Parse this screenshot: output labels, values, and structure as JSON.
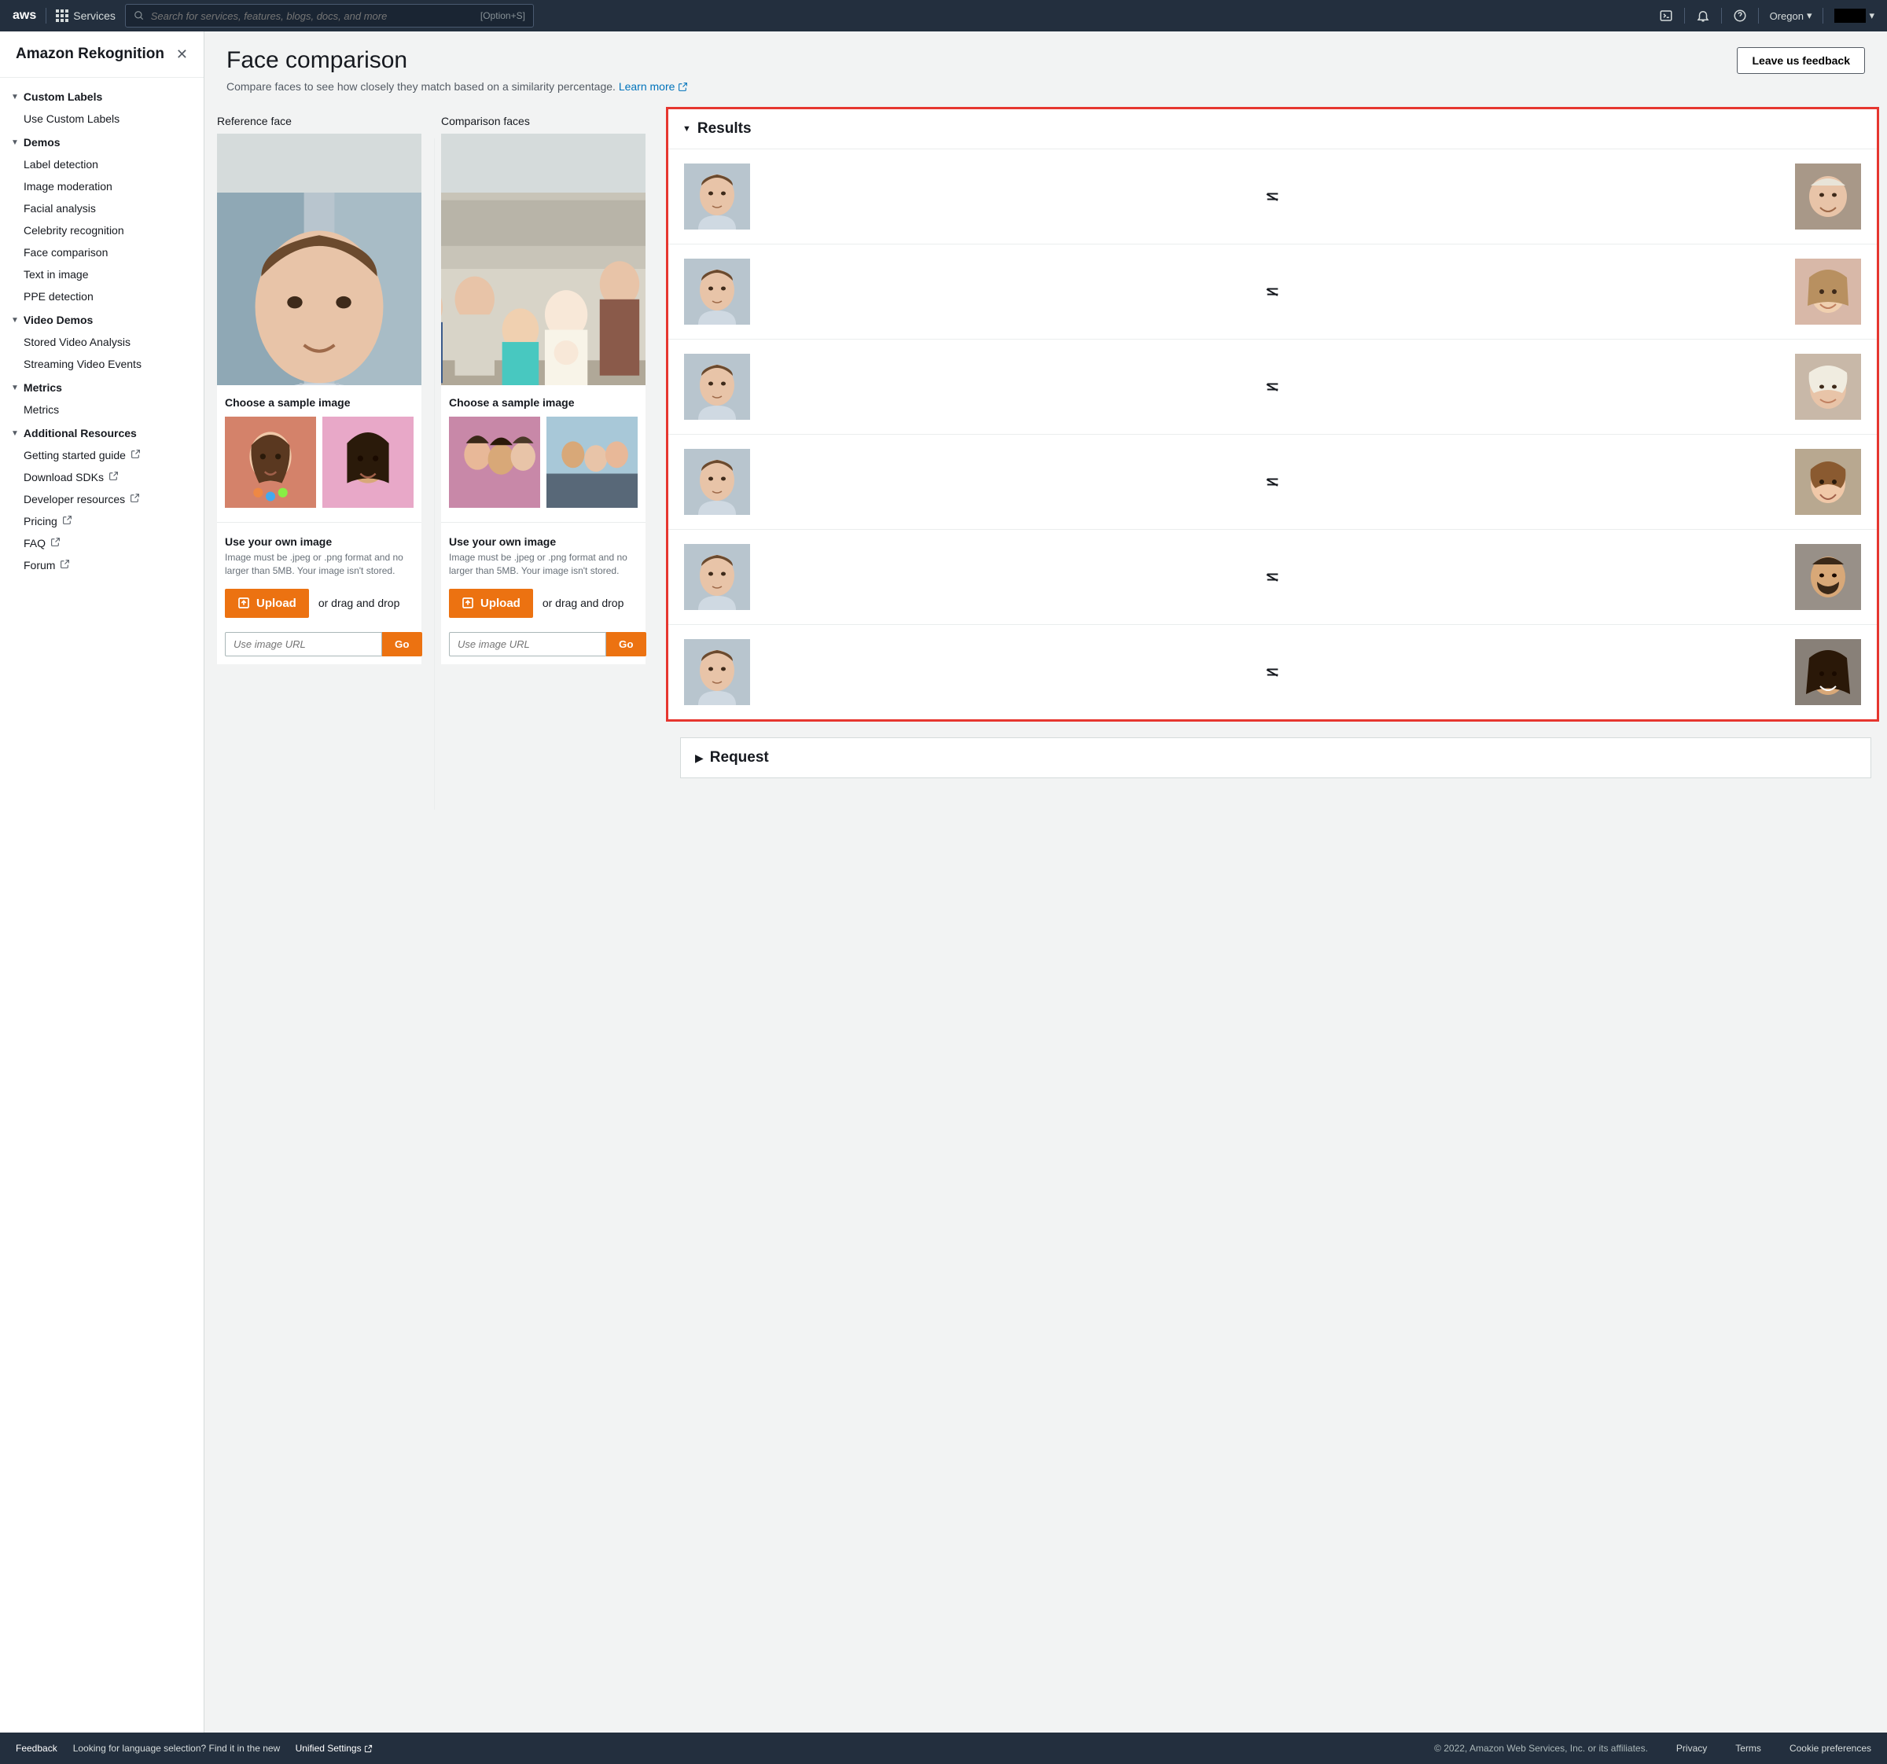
{
  "topnav": {
    "logo": "aws",
    "services": "Services",
    "search_placeholder": "Search for services, features, blogs, docs, and more",
    "shortcut": "[Option+S]",
    "region": "Oregon"
  },
  "sidebar": {
    "title": "Amazon Rekognition",
    "groups": [
      {
        "title": "Custom Labels",
        "items": [
          {
            "label": "Use Custom Labels"
          }
        ]
      },
      {
        "title": "Demos",
        "items": [
          {
            "label": "Label detection"
          },
          {
            "label": "Image moderation"
          },
          {
            "label": "Facial analysis"
          },
          {
            "label": "Celebrity recognition"
          },
          {
            "label": "Face comparison"
          },
          {
            "label": "Text in image"
          },
          {
            "label": "PPE detection"
          }
        ]
      },
      {
        "title": "Video Demos",
        "items": [
          {
            "label": "Stored Video Analysis"
          },
          {
            "label": "Streaming Video Events"
          }
        ]
      },
      {
        "title": "Metrics",
        "items": [
          {
            "label": "Metrics"
          }
        ]
      },
      {
        "title": "Additional Resources",
        "items": [
          {
            "label": "Getting started guide",
            "ext": true
          },
          {
            "label": "Download SDKs",
            "ext": true
          },
          {
            "label": "Developer resources",
            "ext": true
          },
          {
            "label": "Pricing",
            "ext": true
          },
          {
            "label": "FAQ",
            "ext": true
          },
          {
            "label": "Forum",
            "ext": true
          }
        ]
      }
    ]
  },
  "page": {
    "title": "Face comparison",
    "subtitle": "Compare faces to see how closely they match based on a similarity percentage.",
    "learn_more": "Learn more",
    "feedback": "Leave us feedback"
  },
  "ref": {
    "label": "Reference face",
    "choose": "Choose a sample image",
    "own_title": "Use your own image",
    "own_hint": "Image must be .jpeg or .png format and no larger than 5MB. Your image isn't stored.",
    "upload": "Upload",
    "drag": "or drag and drop",
    "url_placeholder": "Use image URL",
    "go": "Go"
  },
  "comp": {
    "label": "Comparison faces",
    "choose": "Choose a sample image",
    "own_title": "Use your own image",
    "own_hint": "Image must be .jpeg or .png format and no larger than 5MB. Your image isn't stored.",
    "upload": "Upload",
    "drag": "or drag and drop",
    "url_placeholder": "Use image URL",
    "go": "Go"
  },
  "results": {
    "title": "Results",
    "rows": [
      {
        "match": false
      },
      {
        "match": false
      },
      {
        "match": false
      },
      {
        "match": false
      },
      {
        "match": false
      },
      {
        "match": false
      }
    ]
  },
  "request": {
    "title": "Request"
  },
  "footer": {
    "feedback": "Feedback",
    "lang_hint": "Looking for language selection? Find it in the new",
    "unified": "Unified Settings",
    "copyright": "© 2022, Amazon Web Services, Inc. or its affiliates.",
    "privacy": "Privacy",
    "terms": "Terms",
    "cookie": "Cookie preferences"
  }
}
